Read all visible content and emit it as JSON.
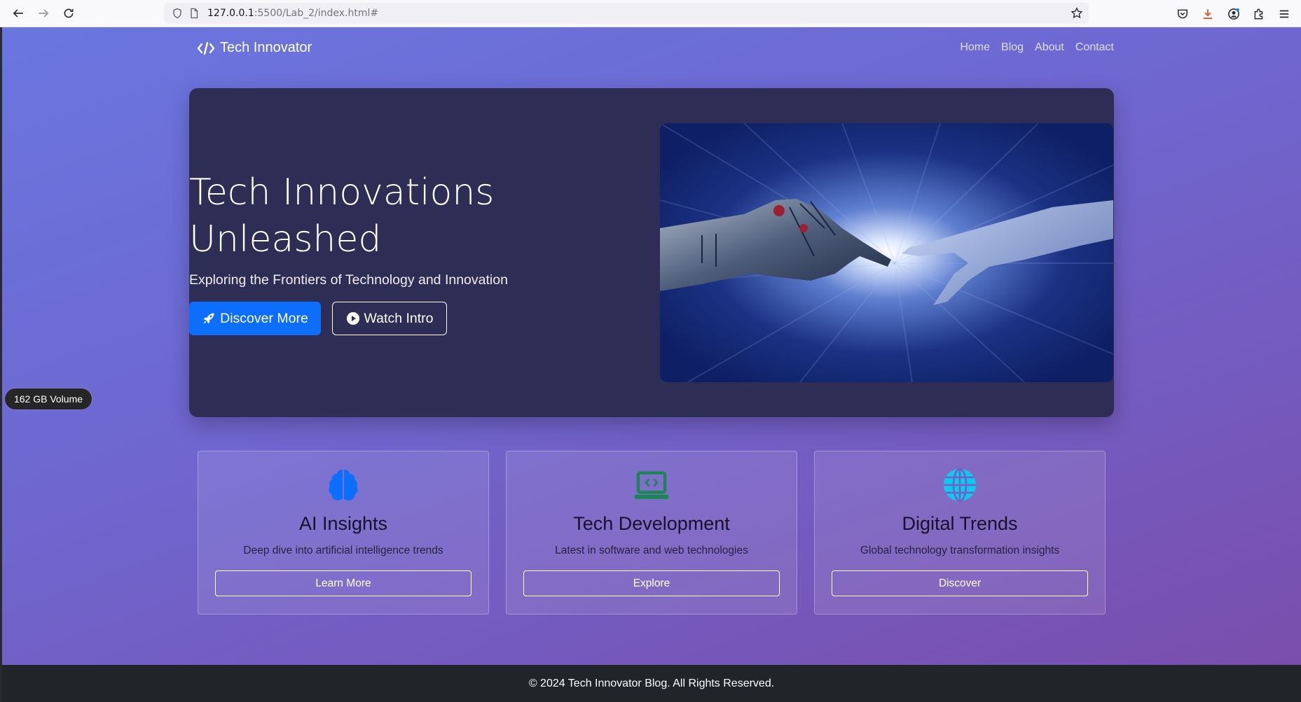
{
  "browser": {
    "url_host": "127.0.0.1",
    "url_rest": ":5500/Lab_2/index.html#",
    "icons": [
      "back-icon",
      "forward-icon",
      "reload-icon",
      "shield-icon",
      "page-icon",
      "star-icon",
      "pocket-icon",
      "download-icon",
      "account-icon",
      "extensions-icon",
      "menu-icon"
    ]
  },
  "site": {
    "brand": "Tech Innovator",
    "nav": [
      "Home",
      "Blog",
      "About",
      "Contact"
    ]
  },
  "hero": {
    "title": "Tech Innovations Unleashed",
    "subtitle": "Exploring the Frontiers of Technology and Innovation",
    "primary_button": "Discover More",
    "secondary_button": "Watch Intro"
  },
  "cards": [
    {
      "icon": "brain-icon",
      "title": "AI Insights",
      "text": "Deep dive into artificial intelligence trends",
      "button": "Learn More",
      "icon_color": "#0d6efd"
    },
    {
      "icon": "laptop-code-icon",
      "title": "Tech Development",
      "text": "Latest in software and web technologies",
      "button": "Explore",
      "icon_color": "#198754"
    },
    {
      "icon": "globe-icon",
      "title": "Digital Trends",
      "text": "Global technology transformation insights",
      "button": "Discover",
      "icon_color": "#0dcaf0"
    }
  ],
  "footer": {
    "text": "© 2024 Tech Innovator Blog. All Rights Reserved."
  },
  "overlay": {
    "volume_label": "162 GB Volume"
  },
  "colors": {
    "primary": "#0d6efd",
    "hero_bg": "#2e2d55",
    "footer_bg": "#212529"
  }
}
